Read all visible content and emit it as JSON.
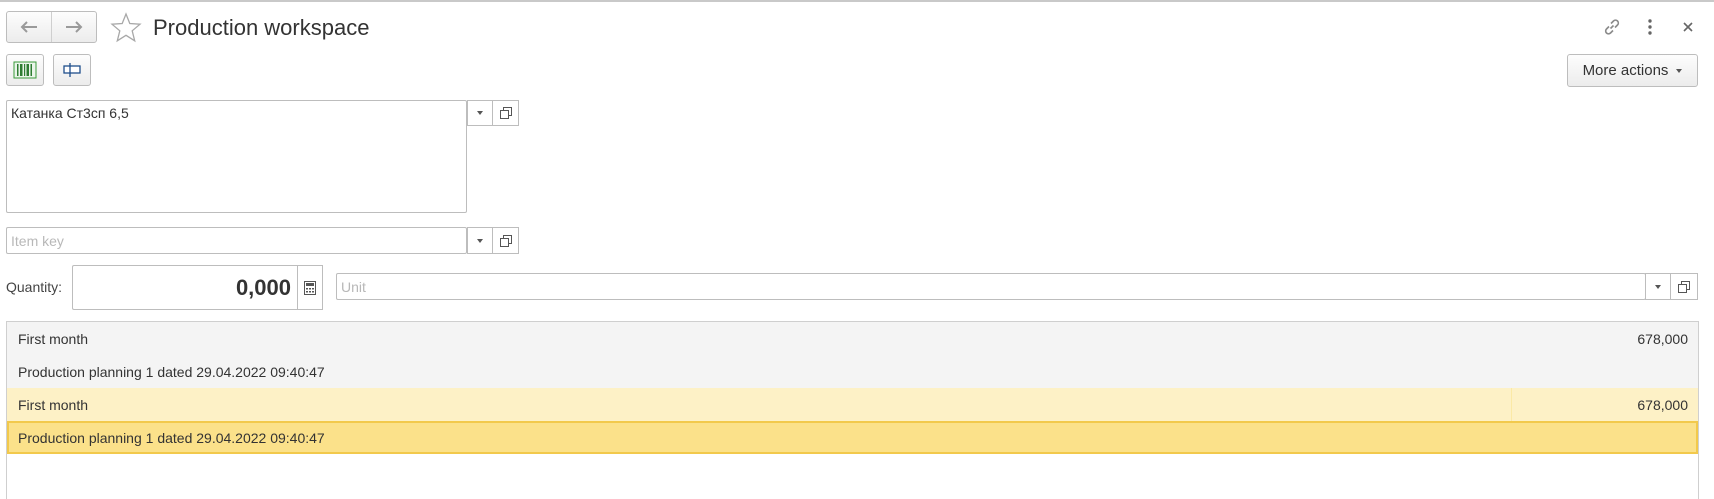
{
  "header": {
    "title": "Production workspace",
    "icons": [
      "back-arrow-icon",
      "forward-arrow-icon",
      "star-icon",
      "link-icon",
      "more-vertical-icon",
      "close-icon"
    ]
  },
  "toolbar": {
    "more_actions_label": "More actions",
    "icons": [
      "barcode-icon",
      "label-icon"
    ]
  },
  "form": {
    "item_name": "Катанка Ст3сп 6,5",
    "item_key_placeholder": "Item key",
    "quantity_label": "Quantity:",
    "quantity_value": "0,000",
    "unit_placeholder": "Unit"
  },
  "table": {
    "rows": [
      {
        "name": "First month",
        "value": "678,000",
        "style": "grey"
      },
      {
        "name": "Production planning 1 dated 29.04.2022 09:40:47",
        "value": "",
        "style": "grey"
      },
      {
        "name": "First month",
        "value": "678,000",
        "style": "yellow"
      },
      {
        "name": "Production planning 1 dated 29.04.2022 09:40:47",
        "value": "",
        "style": "selected"
      }
    ]
  },
  "colors": {
    "accent_yellow": "#fdf1c6",
    "selected_yellow": "#fbe18a",
    "selected_border": "#f2c94c",
    "barcode_green": "#3a9a3a"
  }
}
